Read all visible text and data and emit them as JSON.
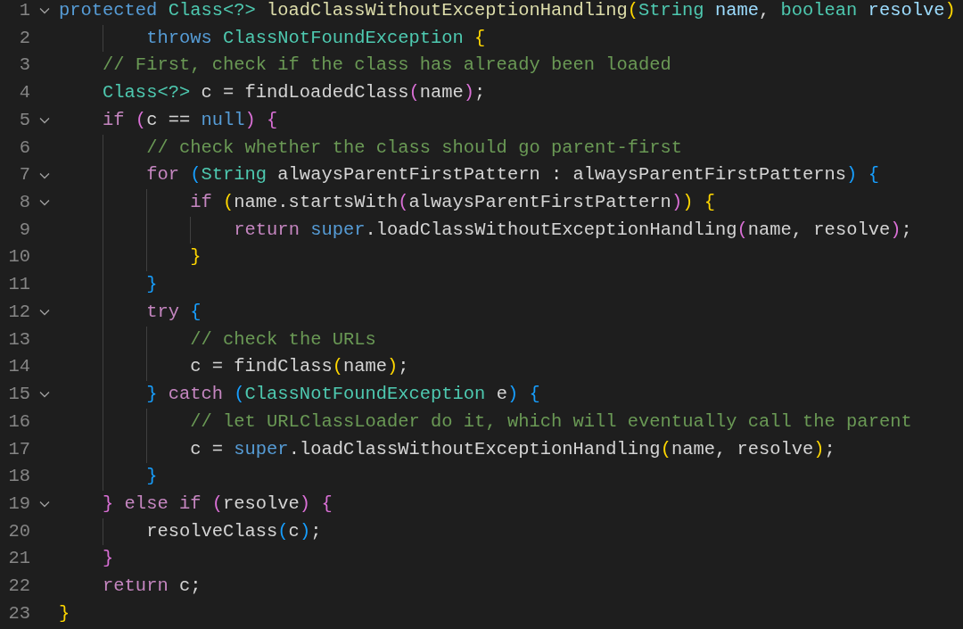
{
  "editor": {
    "lines": [
      {
        "number": "1",
        "expanded": true,
        "tokens": [
          {
            "text": "protected",
            "kind": "keyword"
          },
          {
            "text": " Class<?>",
            "kind": "type"
          },
          {
            "text": " loadClassWithoutExceptionHandling",
            "kind": "function"
          },
          {
            "text": "(",
            "kind": "bracket1"
          },
          {
            "text": "String",
            "kind": "type"
          },
          {
            "text": " name",
            "kind": "parameter"
          },
          {
            "text": ",",
            "kind": "plain"
          },
          {
            "text": " boolean",
            "kind": "type"
          },
          {
            "text": " resolve",
            "kind": "parameter"
          },
          {
            "text": ")",
            "kind": "bracket1"
          }
        ]
      },
      {
        "number": "2",
        "tokens": [
          {
            "text": "        throws",
            "kind": "keyword"
          },
          {
            "text": " ClassNotFoundException",
            "kind": "type"
          },
          {
            "text": " {",
            "kind": "bracket1"
          }
        ]
      },
      {
        "number": "3",
        "tokens": [
          {
            "text": "    // First, check if the class has already been loaded",
            "kind": "comment"
          }
        ]
      },
      {
        "number": "4",
        "tokens": [
          {
            "text": "    Class<?>",
            "kind": "type"
          },
          {
            "text": " c = findLoadedClass",
            "kind": "plain"
          },
          {
            "text": "(",
            "kind": "bracket2"
          },
          {
            "text": "name",
            "kind": "plain"
          },
          {
            "text": ")",
            "kind": "bracket2"
          },
          {
            "text": ";",
            "kind": "plain"
          }
        ]
      },
      {
        "number": "5",
        "expanded": true,
        "tokens": [
          {
            "text": "    if",
            "kind": "control"
          },
          {
            "text": " (",
            "kind": "bracket2"
          },
          {
            "text": "c == ",
            "kind": "plain"
          },
          {
            "text": "null",
            "kind": "keyword"
          },
          {
            "text": ")",
            "kind": "bracket2"
          },
          {
            "text": " {",
            "kind": "bracket2"
          }
        ]
      },
      {
        "number": "6",
        "tokens": [
          {
            "text": "        // check whether the class should go parent-first",
            "kind": "comment"
          }
        ]
      },
      {
        "number": "7",
        "expanded": true,
        "tokens": [
          {
            "text": "        for",
            "kind": "control"
          },
          {
            "text": " (",
            "kind": "bracket3"
          },
          {
            "text": "String",
            "kind": "type"
          },
          {
            "text": " alwaysParentFirstPattern : alwaysParentFirstPatterns",
            "kind": "plain"
          },
          {
            "text": ")",
            "kind": "bracket3"
          },
          {
            "text": " {",
            "kind": "bracket3"
          }
        ]
      },
      {
        "number": "8",
        "expanded": true,
        "tokens": [
          {
            "text": "            if",
            "kind": "control"
          },
          {
            "text": " (",
            "kind": "bracket1"
          },
          {
            "text": "name.startsWith",
            "kind": "plain"
          },
          {
            "text": "(",
            "kind": "bracket2"
          },
          {
            "text": "alwaysParentFirstPattern",
            "kind": "plain"
          },
          {
            "text": ")",
            "kind": "bracket2"
          },
          {
            "text": ")",
            "kind": "bracket1"
          },
          {
            "text": " {",
            "kind": "bracket1"
          }
        ]
      },
      {
        "number": "9",
        "tokens": [
          {
            "text": "                return",
            "kind": "control"
          },
          {
            "text": " super",
            "kind": "keyword"
          },
          {
            "text": ".loadClassWithoutExceptionHandling",
            "kind": "plain"
          },
          {
            "text": "(",
            "kind": "bracket2"
          },
          {
            "text": "name, resolve",
            "kind": "plain"
          },
          {
            "text": ")",
            "kind": "bracket2"
          },
          {
            "text": ";",
            "kind": "plain"
          }
        ]
      },
      {
        "number": "10",
        "tokens": [
          {
            "text": "            }",
            "kind": "bracket1"
          }
        ]
      },
      {
        "number": "11",
        "tokens": [
          {
            "text": "        }",
            "kind": "bracket3"
          }
        ]
      },
      {
        "number": "12",
        "expanded": true,
        "tokens": [
          {
            "text": "        try",
            "kind": "control"
          },
          {
            "text": " {",
            "kind": "bracket3"
          }
        ]
      },
      {
        "number": "13",
        "tokens": [
          {
            "text": "            // check the URLs",
            "kind": "comment"
          }
        ]
      },
      {
        "number": "14",
        "tokens": [
          {
            "text": "            c = findClass",
            "kind": "plain"
          },
          {
            "text": "(",
            "kind": "bracket1"
          },
          {
            "text": "name",
            "kind": "plain"
          },
          {
            "text": ")",
            "kind": "bracket1"
          },
          {
            "text": ";",
            "kind": "plain"
          }
        ]
      },
      {
        "number": "15",
        "expanded": true,
        "tokens": [
          {
            "text": "        }",
            "kind": "bracket3"
          },
          {
            "text": " catch",
            "kind": "control"
          },
          {
            "text": " (",
            "kind": "bracket3"
          },
          {
            "text": "ClassNotFoundException",
            "kind": "type"
          },
          {
            "text": " e",
            "kind": "plain"
          },
          {
            "text": ")",
            "kind": "bracket3"
          },
          {
            "text": " {",
            "kind": "bracket3"
          }
        ]
      },
      {
        "number": "16",
        "tokens": [
          {
            "text": "            // let URLClassLoader do it, which will eventually call the parent",
            "kind": "comment"
          }
        ]
      },
      {
        "number": "17",
        "tokens": [
          {
            "text": "            c = ",
            "kind": "plain"
          },
          {
            "text": "super",
            "kind": "keyword"
          },
          {
            "text": ".loadClassWithoutExceptionHandling",
            "kind": "plain"
          },
          {
            "text": "(",
            "kind": "bracket1"
          },
          {
            "text": "name, resolve",
            "kind": "plain"
          },
          {
            "text": ")",
            "kind": "bracket1"
          },
          {
            "text": ";",
            "kind": "plain"
          }
        ]
      },
      {
        "number": "18",
        "tokens": [
          {
            "text": "        }",
            "kind": "bracket3"
          }
        ]
      },
      {
        "number": "19",
        "expanded": true,
        "tokens": [
          {
            "text": "    }",
            "kind": "bracket2"
          },
          {
            "text": " else if",
            "kind": "control"
          },
          {
            "text": " (",
            "kind": "bracket2"
          },
          {
            "text": "resolve",
            "kind": "plain"
          },
          {
            "text": ")",
            "kind": "bracket2"
          },
          {
            "text": " {",
            "kind": "bracket2"
          }
        ]
      },
      {
        "number": "20",
        "tokens": [
          {
            "text": "        resolveClass",
            "kind": "plain"
          },
          {
            "text": "(",
            "kind": "bracket3"
          },
          {
            "text": "c",
            "kind": "plain"
          },
          {
            "text": ")",
            "kind": "bracket3"
          },
          {
            "text": ";",
            "kind": "plain"
          }
        ]
      },
      {
        "number": "21",
        "tokens": [
          {
            "text": "    }",
            "kind": "bracket2"
          }
        ]
      },
      {
        "number": "22",
        "tokens": [
          {
            "text": "    return",
            "kind": "control"
          },
          {
            "text": " c;",
            "kind": "plain"
          }
        ]
      },
      {
        "number": "23",
        "tokens": [
          {
            "text": "}",
            "kind": "bracket1"
          }
        ]
      }
    ]
  }
}
